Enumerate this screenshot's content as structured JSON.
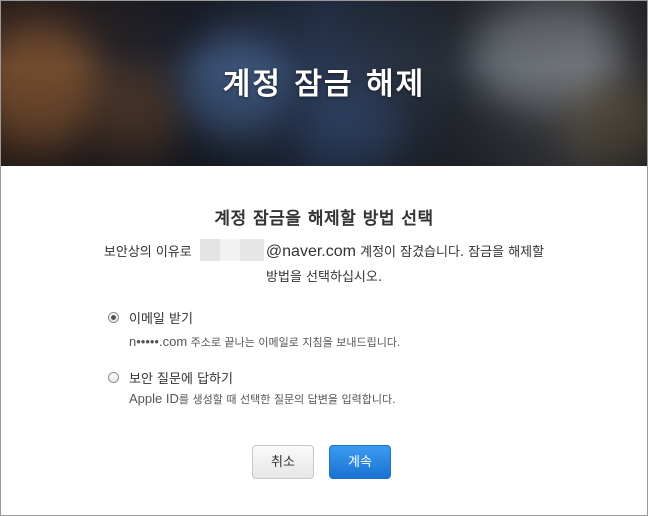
{
  "hero": {
    "title": "계정 잠금 해제"
  },
  "main": {
    "heading": "계정 잠금을 해제할 방법 선택",
    "description": {
      "prefix": "보안상의 이유로",
      "email_domain": "@naver.com",
      "suffix": "계정이 잠겼습니다. 잠금을 해제할",
      "line2": "방법을 선택하십시오."
    }
  },
  "options": [
    {
      "label": "이메일 받기",
      "selected": true,
      "masked_email": "n•••••.com",
      "detail": "주소로 끝나는 이메일로 지침을 보내드립니다."
    },
    {
      "label": "보안 질문에 답하기",
      "selected": false,
      "detail_prefix": "Apple ID",
      "detail": "를 생성할 때 선택한 질문의 답변을 입력합니다."
    }
  ],
  "buttons": {
    "cancel": "취소",
    "continue": "계속"
  },
  "colors": {
    "accent": "#1a73d2",
    "text": "#333333"
  }
}
